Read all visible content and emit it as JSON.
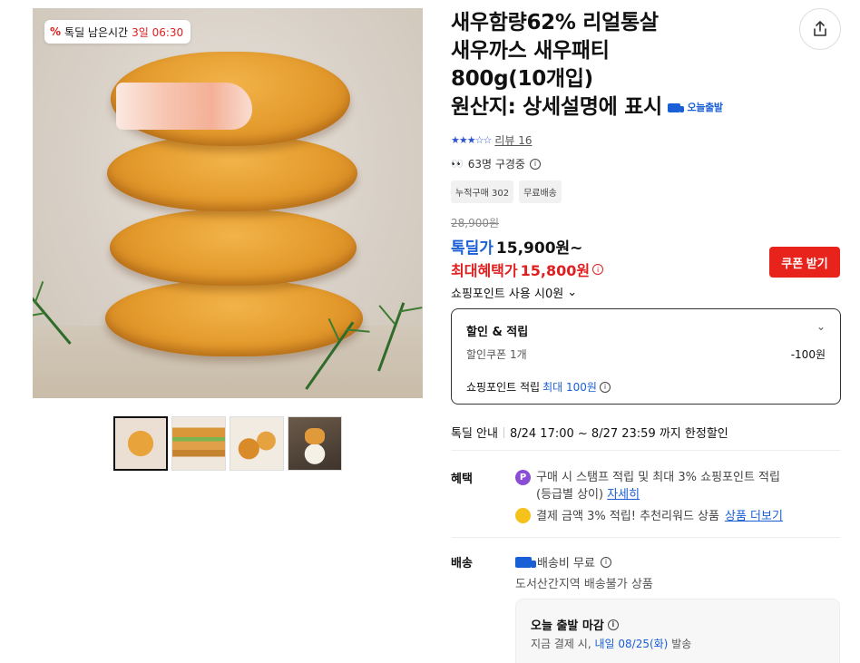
{
  "gallery": {
    "deal_badge": {
      "label": "톡딜 남은시간",
      "timer": "3일 06:30"
    },
    "thumbnails": [
      "thumb-patty-stack",
      "thumb-burger",
      "thumb-patty-halves",
      "thumb-dip"
    ]
  },
  "product": {
    "title_lines": [
      "새우함량62% 리얼통살",
      "새우까스 새우패티",
      "800g(10개입)",
      "원산지: 상세설명에 표시"
    ],
    "today_ship_badge": "오늘출발",
    "rating_stars": 3,
    "review_label": "리뷰 16",
    "viewers": "63명 구경중",
    "tags": [
      "누적구매 302",
      "무료배송"
    ]
  },
  "price": {
    "original": "28,900원",
    "deal_label": "톡딜가",
    "deal_price": "15,900원~",
    "max_label": "최대혜택가",
    "max_price": "15,800원",
    "coupon_button": "쿠폰 받기",
    "point_use": "쇼핑포인트 사용 시0원"
  },
  "discount_box": {
    "title": "할인 & 적립",
    "coupon_label": "할인쿠폰 1개",
    "coupon_value": "-100원",
    "point_label": "쇼핑포인트 적립",
    "point_value": "최대 100원"
  },
  "deal_info": {
    "label": "톡딜 안내",
    "value": "8/24 17:00 ~ 8/27 23:59 까지 한정할인"
  },
  "benefit": {
    "label": "혜택",
    "line1": "구매 시 스탬프 적립 및 최대 3% 쇼핑포인트 적립",
    "line1b": "(등급별 상이)",
    "line1_link": "자세히",
    "line2": "결제 금액 3% 적립! 추천리워드 상품",
    "line2_link": "상품 더보기"
  },
  "shipping": {
    "label": "배송",
    "fee": "배송비 무료",
    "note": "도서산간지역 배송불가 상품",
    "box_title": "오늘 출발 마감",
    "box_sub_prefix": "지금 결제 시,",
    "box_sub_date": "내일 08/25(화)",
    "box_sub_suffix": "발송"
  },
  "colors": {
    "accent_blue": "#1a5fd6",
    "accent_red": "#e02020",
    "coupon_button": "#e8231c"
  }
}
